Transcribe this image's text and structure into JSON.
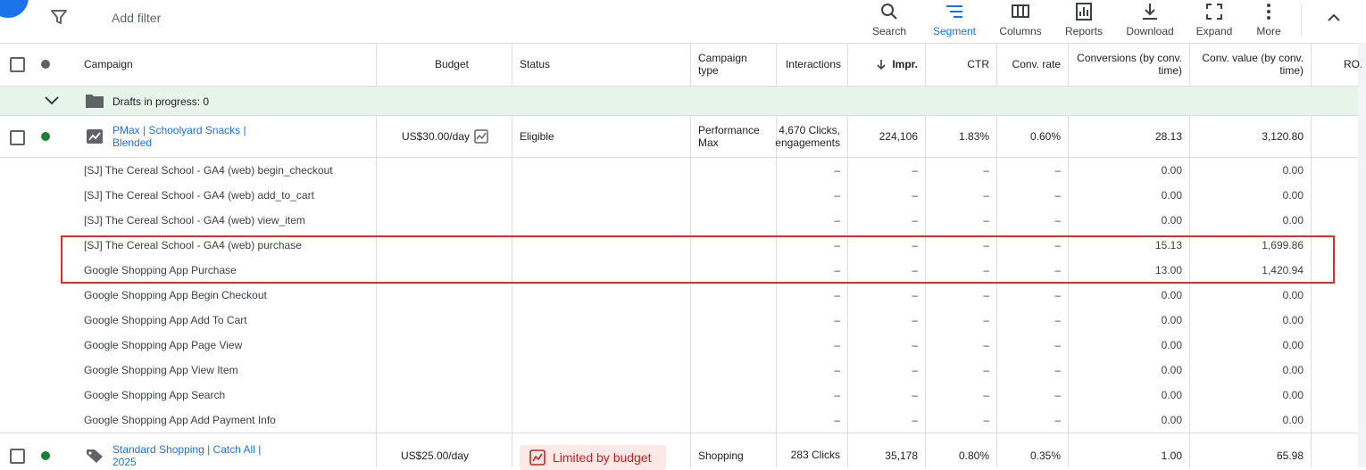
{
  "toolbar": {
    "add_filter": "Add filter",
    "tools": [
      {
        "label": "Search",
        "icon": "search-icon"
      },
      {
        "label": "Segment",
        "icon": "segment-icon"
      },
      {
        "label": "Columns",
        "icon": "columns-icon"
      },
      {
        "label": "Reports",
        "icon": "reports-icon"
      },
      {
        "label": "Download",
        "icon": "download-icon"
      },
      {
        "label": "Expand",
        "icon": "expand-icon"
      },
      {
        "label": "More",
        "icon": "more-icon"
      }
    ]
  },
  "table": {
    "headers": {
      "campaign": "Campaign",
      "budget": "Budget",
      "status": "Status",
      "campaign_type": "Campaign type",
      "interactions": "Interactions",
      "impr": "Impr.",
      "ctr": "CTR",
      "conv_rate": "Conv. rate",
      "conversions": "Conversions (by conv. time)",
      "conv_value": "Conv. value (by conv. time)",
      "roas": "RO..."
    },
    "drafts": "Drafts in progress: 0",
    "campaigns": [
      {
        "name": "PMax | Schoolyard Snacks | Blended",
        "budget": "US$30.00/day",
        "status": "Eligible",
        "type": "Performance Max",
        "interactions": "4,670 Clicks, engagements",
        "impr": "224,106",
        "ctr": "1.83%",
        "conv_rate": "0.60%",
        "conversions": "28.13",
        "conv_value": "3,120.80"
      },
      {
        "name": "Standard Shopping | Catch All | 2025",
        "budget": "US$25.00/day",
        "status": "Limited by budget",
        "type": "Shopping",
        "interactions": "283 Clicks",
        "impr": "35,178",
        "ctr": "0.80%",
        "conv_rate": "0.35%",
        "conversions": "1.00",
        "conv_value": "65.98"
      }
    ],
    "dash": "–",
    "conversion_actions": [
      {
        "name": "[SJ] The Cereal School - GA4 (web) begin_checkout",
        "conversions": "0.00",
        "value": "0.00"
      },
      {
        "name": "[SJ] The Cereal School - GA4 (web) add_to_cart",
        "conversions": "0.00",
        "value": "0.00"
      },
      {
        "name": "[SJ] The Cereal School - GA4 (web) view_item",
        "conversions": "0.00",
        "value": "0.00"
      },
      {
        "name": "[SJ] The Cereal School - GA4 (web) purchase",
        "conversions": "15.13",
        "value": "1,699.86"
      },
      {
        "name": "Google Shopping App Purchase",
        "conversions": "13.00",
        "value": "1,420.94"
      },
      {
        "name": "Google Shopping App Begin Checkout",
        "conversions": "0.00",
        "value": "0.00"
      },
      {
        "name": "Google Shopping App Add To Cart",
        "conversions": "0.00",
        "value": "0.00"
      },
      {
        "name": "Google Shopping App Page View",
        "conversions": "0.00",
        "value": "0.00"
      },
      {
        "name": "Google Shopping App View Item",
        "conversions": "0.00",
        "value": "0.00"
      },
      {
        "name": "Google Shopping App Search",
        "conversions": "0.00",
        "value": "0.00"
      },
      {
        "name": "Google Shopping App Add Payment Info",
        "conversions": "0.00",
        "value": "0.00"
      }
    ]
  },
  "colors": {
    "accent": "#1a73e8",
    "enabled_dot": "#188038",
    "highlight": "#d93025",
    "draft_row": "#e6f4ea"
  }
}
